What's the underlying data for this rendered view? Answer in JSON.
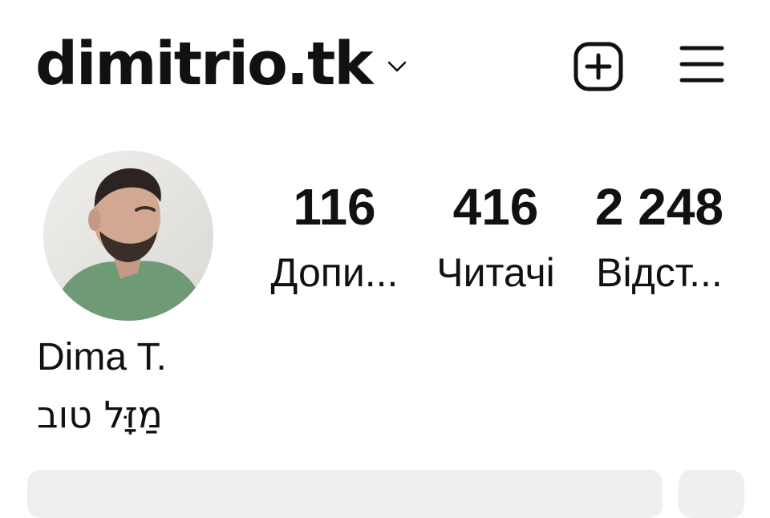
{
  "header": {
    "username": "dimitrio.tk",
    "icons": {
      "account_switcher": "chevron-down-icon",
      "create": "plus-square-icon",
      "menu": "hamburger-menu-icon"
    }
  },
  "profile": {
    "avatar": "profile-photo",
    "stats": [
      {
        "value": "116",
        "label": "Допи..."
      },
      {
        "value": "416",
        "label": "Читачі"
      },
      {
        "value": "2 248",
        "label": "Відст..."
      }
    ],
    "display_name": "Dima T.",
    "bio": "מַזָּל טוב"
  },
  "colors": {
    "text": "#111111",
    "background": "#ffffff",
    "button_bg": "#efefef"
  }
}
